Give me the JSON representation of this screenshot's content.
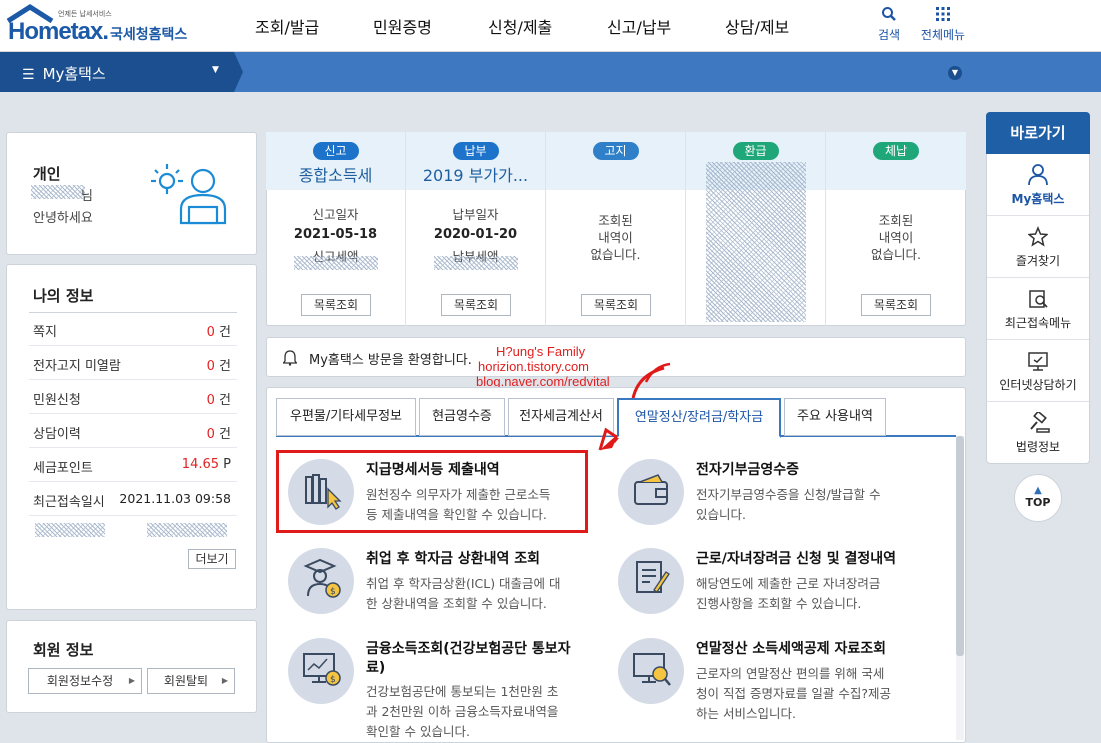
{
  "header": {
    "logo_text": "Hometax.",
    "logo_sub": "국세청홈택스",
    "logo_tagline": "언제든 납세서비스",
    "nav": [
      "조회/발급",
      "민원증명",
      "신청/제출",
      "신고/납부",
      "상담/제보"
    ],
    "search_label": "검색",
    "menu_label": "전체메뉴"
  },
  "bar": {
    "title": "My홈택스"
  },
  "profile": {
    "type": "개인",
    "name_suffix": "님",
    "greeting": "안녕하세요"
  },
  "myinfo": {
    "title": "나의 정보",
    "rows": [
      {
        "label": "쪽지",
        "value": "0",
        "unit": "건"
      },
      {
        "label": "전자고지 미열람",
        "value": "0",
        "unit": "건"
      },
      {
        "label": "민원신청",
        "value": "0",
        "unit": "건"
      },
      {
        "label": "상담이력",
        "value": "0",
        "unit": "건"
      },
      {
        "label": "세금포인트",
        "value": "14.65",
        "unit": "P"
      },
      {
        "label": "최근접속일시",
        "value": "2021.11.03 09:58",
        "unit": ""
      }
    ],
    "more_button": "더보기"
  },
  "member": {
    "title": "회원 정보",
    "edit_button": "회원정보수정",
    "leave_button": "회원탈퇴"
  },
  "status": [
    {
      "badge": "신고",
      "badge_color": "#1c73c9",
      "title": "종합소득세",
      "date_label": "신고일자",
      "date": "2021-05-18",
      "amount_label": "신고세액",
      "button": "목록조회"
    },
    {
      "badge": "납부",
      "badge_color": "#1c73c9",
      "title": "2019 부가가...",
      "date_label": "납부일자",
      "date": "2020-01-20",
      "amount_label": "납부세액",
      "button": "목록조회"
    },
    {
      "badge": "고지",
      "badge_color": "#2f80c8",
      "title": "",
      "msg": [
        "조회된",
        "내역이",
        "없습니다."
      ],
      "button": "목록조회"
    },
    {
      "badge": "환급",
      "badge_color": "#20a779",
      "title": "",
      "msg": [],
      "button": ""
    },
    {
      "badge": "체납",
      "badge_color": "#20a779",
      "title": "",
      "msg": [
        "조회된",
        "내역이",
        "없습니다."
      ],
      "button": "목록조회"
    }
  ],
  "notice": {
    "text": "My홈택스 방문을 환영합니다."
  },
  "watermark": [
    "H?ung's Family",
    "horizion.tistory.com",
    "blog.naver.com/redvital"
  ],
  "tabs": [
    "우편물/기타세무정보",
    "현금영수증",
    "전자세금계산서",
    "연말정산/장려금/학자금",
    "주요 사용내역"
  ],
  "items": [
    {
      "title": "지급명세서등 제출내역",
      "desc": [
        "원천징수 의무자가 제출한 근로소득",
        "등 제출내역을 확인할 수 있습니다."
      ]
    },
    {
      "title": "전자기부금영수증",
      "desc": [
        "전자기부금영수증을 신청/발급할 수",
        "있습니다."
      ]
    },
    {
      "title": "취업 후 학자금 상환내역 조회",
      "desc": [
        "취업 후 학자금상환(ICL) 대출금에 대",
        "한 상환내역을 조회할 수 있습니다."
      ]
    },
    {
      "title": "근로/자녀장려금 신청 및 결정내역",
      "desc": [
        "해당연도에 제출한 근로 자녀장려금",
        "진행사항을 조회할 수 있습니다."
      ]
    },
    {
      "title_lines": [
        "금융소득조회(건강보험공단 통보자",
        "료)"
      ],
      "desc": [
        "건강보험공단에 통보되는 1천만원 초",
        "과 2천만원 이하 금융소득자료내역을",
        "확인할 수 있습니다."
      ]
    },
    {
      "title": "연말정산 소득세액공제 자료조회",
      "desc": [
        "근로자의 연말정산 편의를 위해 국세",
        "청이 직접 증명자료를 일괄 수집?제공",
        "하는 서비스입니다."
      ]
    }
  ],
  "quick": {
    "title": "바로가기",
    "items": [
      {
        "label": "My홈택스",
        "icon": "person-icon"
      },
      {
        "label": "즐겨찾기",
        "icon": "star-icon"
      },
      {
        "label": "최근접속메뉴",
        "icon": "recent-search-icon"
      },
      {
        "label": "인터넷상담하기",
        "icon": "monitor-chat-icon"
      },
      {
        "label": "법령정보",
        "icon": "gavel-icon"
      }
    ],
    "top_label": "TOP"
  },
  "colors": {
    "accent": "#1d55a6",
    "bar": "#3d78c1",
    "highlight": "#e01919"
  }
}
